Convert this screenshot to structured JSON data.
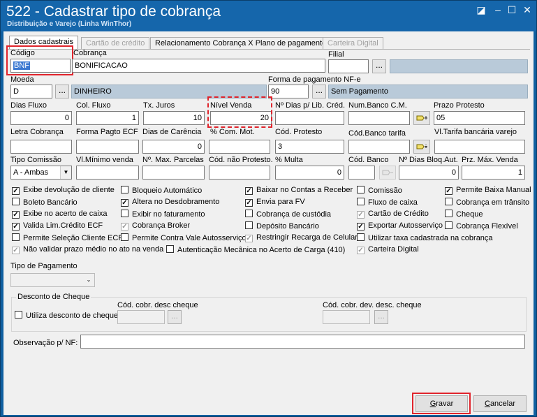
{
  "window": {
    "title": "522 - Cadastrar tipo de cobrança",
    "subtitle": "Distribuição e Varejo (Linha WinThor)",
    "controls": {
      "restore": "◪",
      "minimize": "–",
      "maximize": "☐",
      "close": "✕"
    }
  },
  "tabs": [
    "Dados cadastrais",
    "Cartão de crédito",
    "Relacionamento Cobrança X Plano de pagamento",
    "Carteira Digital"
  ],
  "fields": {
    "codigo": {
      "label": "Código",
      "value": "BNF"
    },
    "cobranca": {
      "label": "Cobrança",
      "value": "BONIFICACAO"
    },
    "filial": {
      "label": "Filial",
      "value": "",
      "button": "..."
    },
    "moeda": {
      "label": "Moeda",
      "value": "D",
      "button": "...",
      "desc": "DINHEIRO"
    },
    "forma_pag_nfe": {
      "label": "Forma de pagamento NF-e",
      "value": "90",
      "button": "...",
      "desc": "Sem Pagamento"
    },
    "dias_fluxo": {
      "label": "Dias Fluxo",
      "value": "0"
    },
    "col_fluxo": {
      "label": "Col. Fluxo",
      "value": "1"
    },
    "tx_juros": {
      "label": "Tx. Juros",
      "value": "10"
    },
    "nivel_venda": {
      "label": "Nível Venda",
      "value": "20"
    },
    "dias_lib_cred": {
      "label": "Nº Dias p/ Lib. Créd.",
      "value": ""
    },
    "num_banco_cm": {
      "label": "Num.Banco C.M.",
      "value": ""
    },
    "prazo_protesto": {
      "label": "Prazo Protesto",
      "value": "05"
    },
    "letra_cobranca": {
      "label": "Letra Cobrança",
      "value": ""
    },
    "forma_pagto_ecf": {
      "label": "Forma Pagto ECF",
      "value": ""
    },
    "dias_carencia": {
      "label": "Dias de Carência",
      "value": "0"
    },
    "pct_com_mot": {
      "label": "% Com. Mot.",
      "value": ""
    },
    "cod_protesto": {
      "label": "Cód. Protesto",
      "value": "3"
    },
    "cod_banco_tarifa": {
      "label": "Cód.Banco tarifa",
      "value": ""
    },
    "vl_tarifa": {
      "label": "Vl.Tarifa bancária varejo",
      "value": ""
    },
    "tipo_comissao": {
      "label": "Tipo Comissão",
      "value": "A - Ambas"
    },
    "vl_minimo_venda": {
      "label": "Vl.Mínimo venda",
      "value": ""
    },
    "max_parcelas": {
      "label": "Nº. Max. Parcelas",
      "value": ""
    },
    "cod_nao_protesto": {
      "label": "Cód. não Protesto.",
      "value": ""
    },
    "pct_multa": {
      "label": "% Multa",
      "value": "0"
    },
    "cod_banco": {
      "label": "Cód. Banco",
      "value": ""
    },
    "dias_bloq_aut": {
      "label": "Nº Dias Bloq.Aut.",
      "value": "0"
    },
    "prz_max_venda": {
      "label": "Prz. Máx. Venda",
      "value": "1"
    },
    "tipo_pagamento": {
      "label": "Tipo de Pagamento",
      "value": ""
    },
    "observacao": {
      "label": "Observação p/ NF:",
      "value": ""
    }
  },
  "checkboxes": [
    {
      "label": "Exibe devolução de cliente",
      "checked": true
    },
    {
      "label": "Boleto Bancário",
      "checked": false
    },
    {
      "label": "Exibe no acerto de caixa",
      "checked": true
    },
    {
      "label": "Valida Lim.Crédito ECF",
      "checked": true
    },
    {
      "label": "Permite Seleção Cliente ECF",
      "checked": false
    },
    {
      "label": "Não validar prazo médio no ato na venda",
      "checked": true,
      "disabled": true
    },
    {
      "label": "Bloqueio Automático",
      "checked": false
    },
    {
      "label": "Altera no Desdobramento",
      "checked": true
    },
    {
      "label": "Exibir no faturamento",
      "checked": false
    },
    {
      "label": "Cobrança Broker",
      "checked": true,
      "disabled": true
    },
    {
      "label": "Permite Contra Vale Autosserviço",
      "checked": false
    },
    {
      "label": "Autenticação Mecânica no Acerto de Carga (410)",
      "checked": false
    },
    {
      "label": "Baixar no Contas a Receber",
      "checked": true
    },
    {
      "label": "Envia para FV",
      "checked": true
    },
    {
      "label": "Cobrança de custódia",
      "checked": false
    },
    {
      "label": "Depósito Bancário",
      "checked": false
    },
    {
      "label": "Restringir Recarga de Celular",
      "checked": true,
      "disabled": true
    },
    {
      "label": "Comissão",
      "checked": false
    },
    {
      "label": "Fluxo de caixa",
      "checked": false
    },
    {
      "label": "Cartão de Crédito",
      "checked": true,
      "disabled": true
    },
    {
      "label": "Exportar Autosserviço",
      "checked": true
    },
    {
      "label": "Utilizar taxa cadastrada na cobrança",
      "checked": false
    },
    {
      "label": "Carteira Digital",
      "checked": true,
      "disabled": true
    },
    {
      "label": "Permite Baixa Manual",
      "checked": true
    },
    {
      "label": "Cobrança em trânsito",
      "checked": false
    },
    {
      "label": "Cheque",
      "checked": false
    },
    {
      "label": "Cobrança Flexível",
      "checked": false
    }
  ],
  "desconto_cheque": {
    "group": "Desconto de Cheque",
    "utiliza": "Utiliza desconto de cheque",
    "cod_cobr_desc": "Cód. cobr. desc cheque",
    "cod_cobr_dev": "Cód. cobr. dev. desc. cheque",
    "button": "..."
  },
  "buttons": {
    "gravar_pre": "",
    "gravar_u": "G",
    "gravar_post": "ravar",
    "cancelar_pre": "",
    "cancelar_u": "C",
    "cancelar_post": "ancelar"
  },
  "colors": {
    "titlebar": "#1566ab",
    "highlight": "#e0242c",
    "readonly": "#b9cad9"
  }
}
